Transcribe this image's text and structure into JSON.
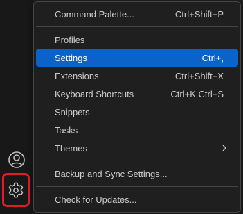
{
  "menu": {
    "items": [
      {
        "label": "Command Palette...",
        "shortcut": "Ctrl+Shift+P"
      },
      {
        "label": "Profiles",
        "shortcut": ""
      },
      {
        "label": "Settings",
        "shortcut": "Ctrl+,",
        "selected": true
      },
      {
        "label": "Extensions",
        "shortcut": "Ctrl+Shift+X"
      },
      {
        "label": "Keyboard Shortcuts",
        "shortcut": "Ctrl+K Ctrl+S"
      },
      {
        "label": "Snippets",
        "shortcut": ""
      },
      {
        "label": "Tasks",
        "shortcut": ""
      },
      {
        "label": "Themes",
        "shortcut": "",
        "submenu": true
      },
      {
        "label": "Backup and Sync Settings...",
        "shortcut": ""
      },
      {
        "label": "Check for Updates...",
        "shortcut": ""
      }
    ]
  },
  "activity_bar": {
    "account_icon": "account-icon",
    "manage_icon": "gear-icon"
  },
  "colors": {
    "selection": "#0a63c9",
    "highlight_border": "#e4192a",
    "menu_bg": "#1f1f1f",
    "text": "#cccccc"
  }
}
